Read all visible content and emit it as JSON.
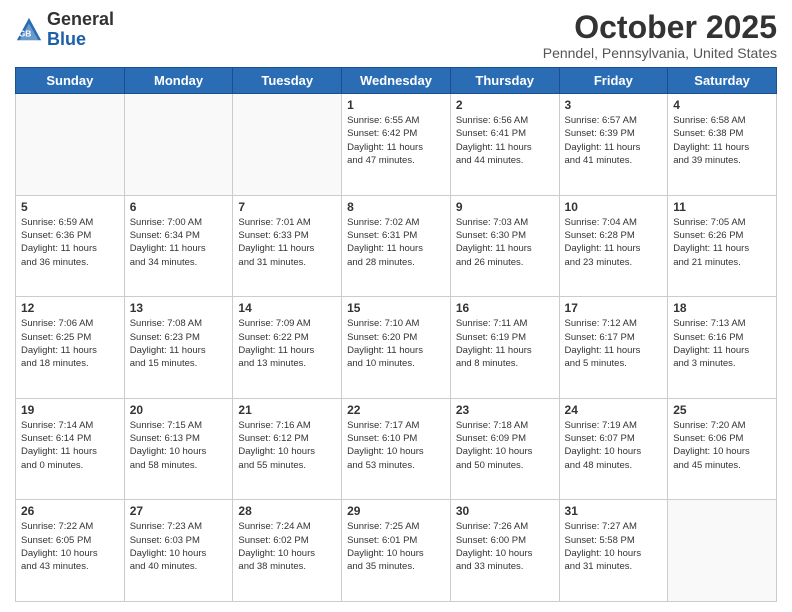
{
  "logo": {
    "general": "General",
    "blue": "Blue"
  },
  "header": {
    "month": "October 2025",
    "location": "Penndel, Pennsylvania, United States"
  },
  "days_of_week": [
    "Sunday",
    "Monday",
    "Tuesday",
    "Wednesday",
    "Thursday",
    "Friday",
    "Saturday"
  ],
  "weeks": [
    [
      {
        "day": "",
        "info": ""
      },
      {
        "day": "",
        "info": ""
      },
      {
        "day": "",
        "info": ""
      },
      {
        "day": "1",
        "info": "Sunrise: 6:55 AM\nSunset: 6:42 PM\nDaylight: 11 hours\nand 47 minutes."
      },
      {
        "day": "2",
        "info": "Sunrise: 6:56 AM\nSunset: 6:41 PM\nDaylight: 11 hours\nand 44 minutes."
      },
      {
        "day": "3",
        "info": "Sunrise: 6:57 AM\nSunset: 6:39 PM\nDaylight: 11 hours\nand 41 minutes."
      },
      {
        "day": "4",
        "info": "Sunrise: 6:58 AM\nSunset: 6:38 PM\nDaylight: 11 hours\nand 39 minutes."
      }
    ],
    [
      {
        "day": "5",
        "info": "Sunrise: 6:59 AM\nSunset: 6:36 PM\nDaylight: 11 hours\nand 36 minutes."
      },
      {
        "day": "6",
        "info": "Sunrise: 7:00 AM\nSunset: 6:34 PM\nDaylight: 11 hours\nand 34 minutes."
      },
      {
        "day": "7",
        "info": "Sunrise: 7:01 AM\nSunset: 6:33 PM\nDaylight: 11 hours\nand 31 minutes."
      },
      {
        "day": "8",
        "info": "Sunrise: 7:02 AM\nSunset: 6:31 PM\nDaylight: 11 hours\nand 28 minutes."
      },
      {
        "day": "9",
        "info": "Sunrise: 7:03 AM\nSunset: 6:30 PM\nDaylight: 11 hours\nand 26 minutes."
      },
      {
        "day": "10",
        "info": "Sunrise: 7:04 AM\nSunset: 6:28 PM\nDaylight: 11 hours\nand 23 minutes."
      },
      {
        "day": "11",
        "info": "Sunrise: 7:05 AM\nSunset: 6:26 PM\nDaylight: 11 hours\nand 21 minutes."
      }
    ],
    [
      {
        "day": "12",
        "info": "Sunrise: 7:06 AM\nSunset: 6:25 PM\nDaylight: 11 hours\nand 18 minutes."
      },
      {
        "day": "13",
        "info": "Sunrise: 7:08 AM\nSunset: 6:23 PM\nDaylight: 11 hours\nand 15 minutes."
      },
      {
        "day": "14",
        "info": "Sunrise: 7:09 AM\nSunset: 6:22 PM\nDaylight: 11 hours\nand 13 minutes."
      },
      {
        "day": "15",
        "info": "Sunrise: 7:10 AM\nSunset: 6:20 PM\nDaylight: 11 hours\nand 10 minutes."
      },
      {
        "day": "16",
        "info": "Sunrise: 7:11 AM\nSunset: 6:19 PM\nDaylight: 11 hours\nand 8 minutes."
      },
      {
        "day": "17",
        "info": "Sunrise: 7:12 AM\nSunset: 6:17 PM\nDaylight: 11 hours\nand 5 minutes."
      },
      {
        "day": "18",
        "info": "Sunrise: 7:13 AM\nSunset: 6:16 PM\nDaylight: 11 hours\nand 3 minutes."
      }
    ],
    [
      {
        "day": "19",
        "info": "Sunrise: 7:14 AM\nSunset: 6:14 PM\nDaylight: 11 hours\nand 0 minutes."
      },
      {
        "day": "20",
        "info": "Sunrise: 7:15 AM\nSunset: 6:13 PM\nDaylight: 10 hours\nand 58 minutes."
      },
      {
        "day": "21",
        "info": "Sunrise: 7:16 AM\nSunset: 6:12 PM\nDaylight: 10 hours\nand 55 minutes."
      },
      {
        "day": "22",
        "info": "Sunrise: 7:17 AM\nSunset: 6:10 PM\nDaylight: 10 hours\nand 53 minutes."
      },
      {
        "day": "23",
        "info": "Sunrise: 7:18 AM\nSunset: 6:09 PM\nDaylight: 10 hours\nand 50 minutes."
      },
      {
        "day": "24",
        "info": "Sunrise: 7:19 AM\nSunset: 6:07 PM\nDaylight: 10 hours\nand 48 minutes."
      },
      {
        "day": "25",
        "info": "Sunrise: 7:20 AM\nSunset: 6:06 PM\nDaylight: 10 hours\nand 45 minutes."
      }
    ],
    [
      {
        "day": "26",
        "info": "Sunrise: 7:22 AM\nSunset: 6:05 PM\nDaylight: 10 hours\nand 43 minutes."
      },
      {
        "day": "27",
        "info": "Sunrise: 7:23 AM\nSunset: 6:03 PM\nDaylight: 10 hours\nand 40 minutes."
      },
      {
        "day": "28",
        "info": "Sunrise: 7:24 AM\nSunset: 6:02 PM\nDaylight: 10 hours\nand 38 minutes."
      },
      {
        "day": "29",
        "info": "Sunrise: 7:25 AM\nSunset: 6:01 PM\nDaylight: 10 hours\nand 35 minutes."
      },
      {
        "day": "30",
        "info": "Sunrise: 7:26 AM\nSunset: 6:00 PM\nDaylight: 10 hours\nand 33 minutes."
      },
      {
        "day": "31",
        "info": "Sunrise: 7:27 AM\nSunset: 5:58 PM\nDaylight: 10 hours\nand 31 minutes."
      },
      {
        "day": "",
        "info": ""
      }
    ]
  ]
}
